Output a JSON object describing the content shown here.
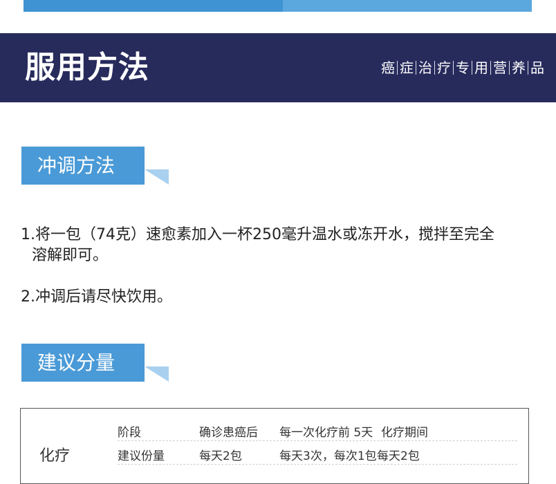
{
  "header": {
    "title": "服用方法",
    "tags": [
      "癌",
      "症",
      "治",
      "疗",
      "专",
      "用",
      "营",
      "养",
      "品"
    ]
  },
  "sections": {
    "mixing": {
      "label": "冲调方法",
      "step1_line1": "1.将一包（74克）速愈素加入一杯250毫升温水或冻开水，搅拌至完全",
      "step1_line2": "溶解即可。",
      "step2": "2.冲调后请尽快饮用。"
    },
    "dosage": {
      "label": "建议分量",
      "row_label": "化疗",
      "header_row": [
        "阶段",
        "确诊患癌后",
        "每一次化疗前 5天",
        "化疗期间"
      ],
      "dose_row": [
        "建议份量",
        "每天2包",
        "每天3次，每次1包",
        "每天2包"
      ]
    }
  },
  "colors": {
    "header_bg": "#272b5c",
    "accent_blue": "#4a9ad7",
    "accent_light": "#a9d0ee"
  }
}
